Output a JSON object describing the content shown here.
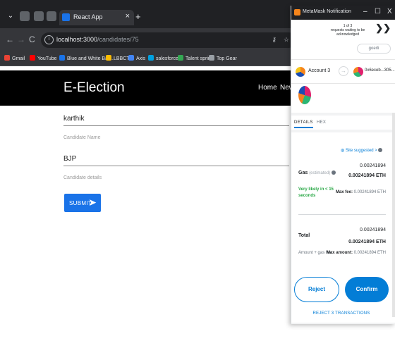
{
  "browser": {
    "tab_title": "React App",
    "tab_close": "×",
    "new_tab": "+",
    "url_host": "localhost:3000",
    "url_path": "/candidates/75",
    "bookmarks": [
      {
        "label": "Gmail",
        "color": "#ea4335"
      },
      {
        "label": "YouTube",
        "color": "#ff0000"
      },
      {
        "label": "Blue and White Bar...",
        "color": "#1a73e8"
      },
      {
        "label": "LBBCT",
        "color": "#fbbc04"
      },
      {
        "label": "Axis",
        "color": "#4285f4"
      },
      {
        "label": "salesforce",
        "color": "#00a1e0"
      },
      {
        "label": "Talent sprint",
        "color": "#34a853"
      },
      {
        "label": "Top Gear",
        "color": "#9aa0a6"
      }
    ]
  },
  "page": {
    "brand": "E-Election",
    "nav": [
      "Home",
      "New"
    ],
    "fields": [
      {
        "value": "karthik",
        "label": "Candidate Name"
      },
      {
        "value": "BJP",
        "label": "Candidate details"
      }
    ],
    "submit_label": "SUBMIT",
    "submit_arrow": "➤"
  },
  "metamask": {
    "window_title": "MetaMask Notification",
    "window_controls": [
      "–",
      "☐",
      "X"
    ],
    "queue_count": "1 of 3",
    "queue_text": "requests waiting to be acknowledged",
    "queue_arrows": "❯❯",
    "network": "goerli",
    "account_name": "Account 3",
    "transfer_arrow": "→",
    "dest_address": "0x6eceb...305...",
    "tabs": [
      "DETAILS",
      "HEX"
    ],
    "site_suggested": "Site suggested",
    "site_suggested_arrow": ">",
    "gas_label": "Gas",
    "gas_estimated": "(estimated)",
    "gas_amount": "0.00241894",
    "gas_amount_eth": "0.00241894 ETH",
    "likely": "Very likely in < 15 seconds",
    "max_fee_label": "Max fee:",
    "max_fee_value": "0.00241894 ETH",
    "total_label": "Total",
    "total_amount": "0.00241894",
    "total_amount_eth": "0.00241894 ETH",
    "amount_gas": "Amount + gas fee",
    "max_amount_label": "Max amount:",
    "max_amount_value": "0.00241894 ETH",
    "reject_label": "Reject",
    "confirm_label": "Confirm",
    "reject_all_label": "REJECT 3 TRANSACTIONS"
  }
}
